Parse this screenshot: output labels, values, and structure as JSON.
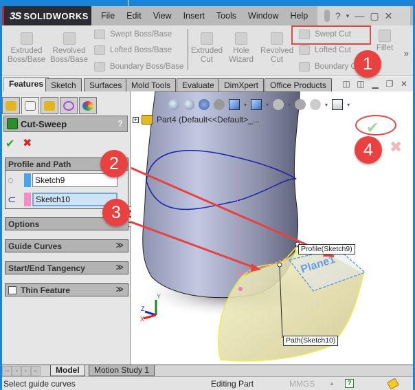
{
  "app": {
    "brand": "SOLIDWORKS",
    "brand_mark": "3S"
  },
  "menu": {
    "items": [
      "File",
      "Edit",
      "View",
      "Insert",
      "Tools",
      "Window",
      "Help"
    ],
    "right_icons": [
      "pin-icon",
      "traffic-light-icon",
      "help-icon",
      "minimize-icon",
      "restore-icon",
      "close-icon"
    ],
    "help_glyph": "?",
    "dropdown_glyph": "▾",
    "minimize_glyph": "—",
    "restore_glyph": "▢",
    "close_glyph": "✕"
  },
  "command_manager": {
    "boss_commands": [
      {
        "label": "Extruded\nBoss/Base",
        "line1": "Extruded",
        "line2": "Boss/Base"
      },
      {
        "label": "Revolved\nBoss/Base",
        "line1": "Revolved",
        "line2": "Boss/Base"
      }
    ],
    "boss_stack": [
      "Swept Boss/Base",
      "Lofted Boss/Base",
      "Boundary Boss/Base"
    ],
    "cut_commands": [
      {
        "line1": "Extruded",
        "line2": "Cut"
      },
      {
        "line1": "Hole",
        "line2": "Wizard"
      },
      {
        "line1": "Revolved",
        "line2": "Cut"
      }
    ],
    "cut_stack": [
      "Swept Cut",
      "Lofted Cut",
      "Boundary Cut"
    ],
    "fillet": "Fillet",
    "more_glyph": "»",
    "highlighted": "Swept Cut"
  },
  "tabs": {
    "items": [
      "Features",
      "Sketch",
      "Surfaces",
      "Mold Tools",
      "Evaluate",
      "DimXpert",
      "Office Products"
    ],
    "active": "Features"
  },
  "doc_window_controls": [
    "tile-left-icon",
    "tile-right-icon",
    "minimize-icon",
    "restore-icon",
    "close-icon"
  ],
  "property_manager": {
    "tabs": [
      "feature-manager-tab",
      "property-manager-tab",
      "configuration-manager-tab",
      "dimxpert-manager-tab",
      "display-manager-tab"
    ],
    "active_tab": "property-manager-tab",
    "title": "Cut-Sweep",
    "help_glyph": "?",
    "ok_glyph": "✔",
    "cancel_glyph": "✖",
    "groups": {
      "profile_path": {
        "title": "Profile and Path",
        "profile": {
          "value": "Sketch9",
          "color": "#4aa3f0"
        },
        "path": {
          "value": "Sketch10",
          "color": "#f38fc6"
        }
      },
      "options": {
        "title": "Options"
      },
      "guide_curves": {
        "title": "Guide Curves"
      },
      "tangency": {
        "title": "Start/End Tangency"
      },
      "thin_feature": {
        "title": "Thin Feature",
        "checked": false
      }
    },
    "chevron_glyph": "≫",
    "chevron_up_glyph": "⌃"
  },
  "viewport": {
    "tree_root": "Part4  (Default<<Default>_...",
    "expander_glyph": "+",
    "ok_glyph": "✔",
    "cancel_glyph": "✖",
    "callouts": {
      "profile": "Profile(Sketch9)",
      "path": "Path(Sketch10)",
      "plane": "Plane1"
    },
    "triad": {
      "x": "X",
      "y": "Y",
      "z": "Z"
    }
  },
  "annotations": {
    "badges": [
      "1",
      "2",
      "3",
      "4"
    ],
    "accent": "#e8413f"
  },
  "bottom_tabs": {
    "items": [
      "Model",
      "Motion Study 1"
    ],
    "active": "Model"
  },
  "status": {
    "message": "Select guide curves",
    "mode": "Editing Part",
    "units": "MMGS",
    "units_arrow": "▲",
    "quick_help": "?"
  }
}
